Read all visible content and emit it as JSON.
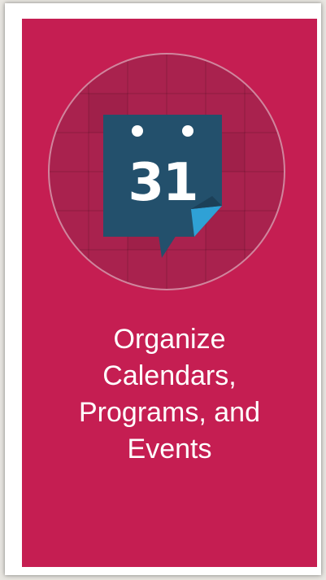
{
  "tile": {
    "background_color": "#c51e52",
    "icon": "calendar-icon",
    "calendar_day": "31",
    "caption_lines": [
      "Organize",
      "Calendars,",
      "Programs, and",
      "Events"
    ]
  },
  "colors": {
    "calendar_body": "#23506c",
    "calendar_fold": "#2fa1d6",
    "circle_fill": "#a9224e"
  }
}
